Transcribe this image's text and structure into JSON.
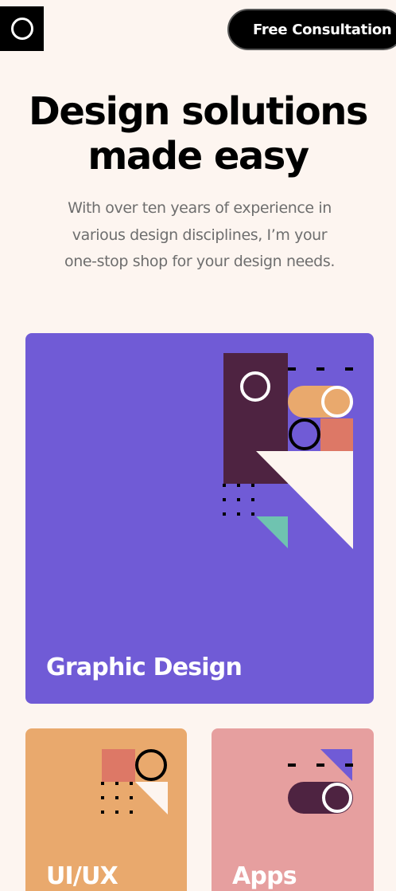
{
  "header": {
    "logo_icon": "ring-logo-icon",
    "cta_label": "Free Consultation"
  },
  "hero": {
    "title": "Design solutions made easy",
    "subtitle": "With over ten years of experience in various design disciplines, I’m your one-stop shop for your design needs."
  },
  "services": [
    {
      "title": "Graphic Design",
      "color": "#705bd6",
      "illustration": "geometric-shapes-illustration"
    },
    {
      "title": "UI/UX",
      "color": "#e9a96d",
      "illustration": "geometric-shapes-illustration"
    },
    {
      "title": "Apps",
      "color": "#e69f9f",
      "illustration": "geometric-shapes-illustration"
    }
  ],
  "colors": {
    "background": "#fdf5f0",
    "purple": "#705bd6",
    "orange": "#e9a96d",
    "pink": "#e69f9f",
    "plum": "#4e2341",
    "coral": "#dd7866",
    "teal": "#6fc3b0"
  }
}
